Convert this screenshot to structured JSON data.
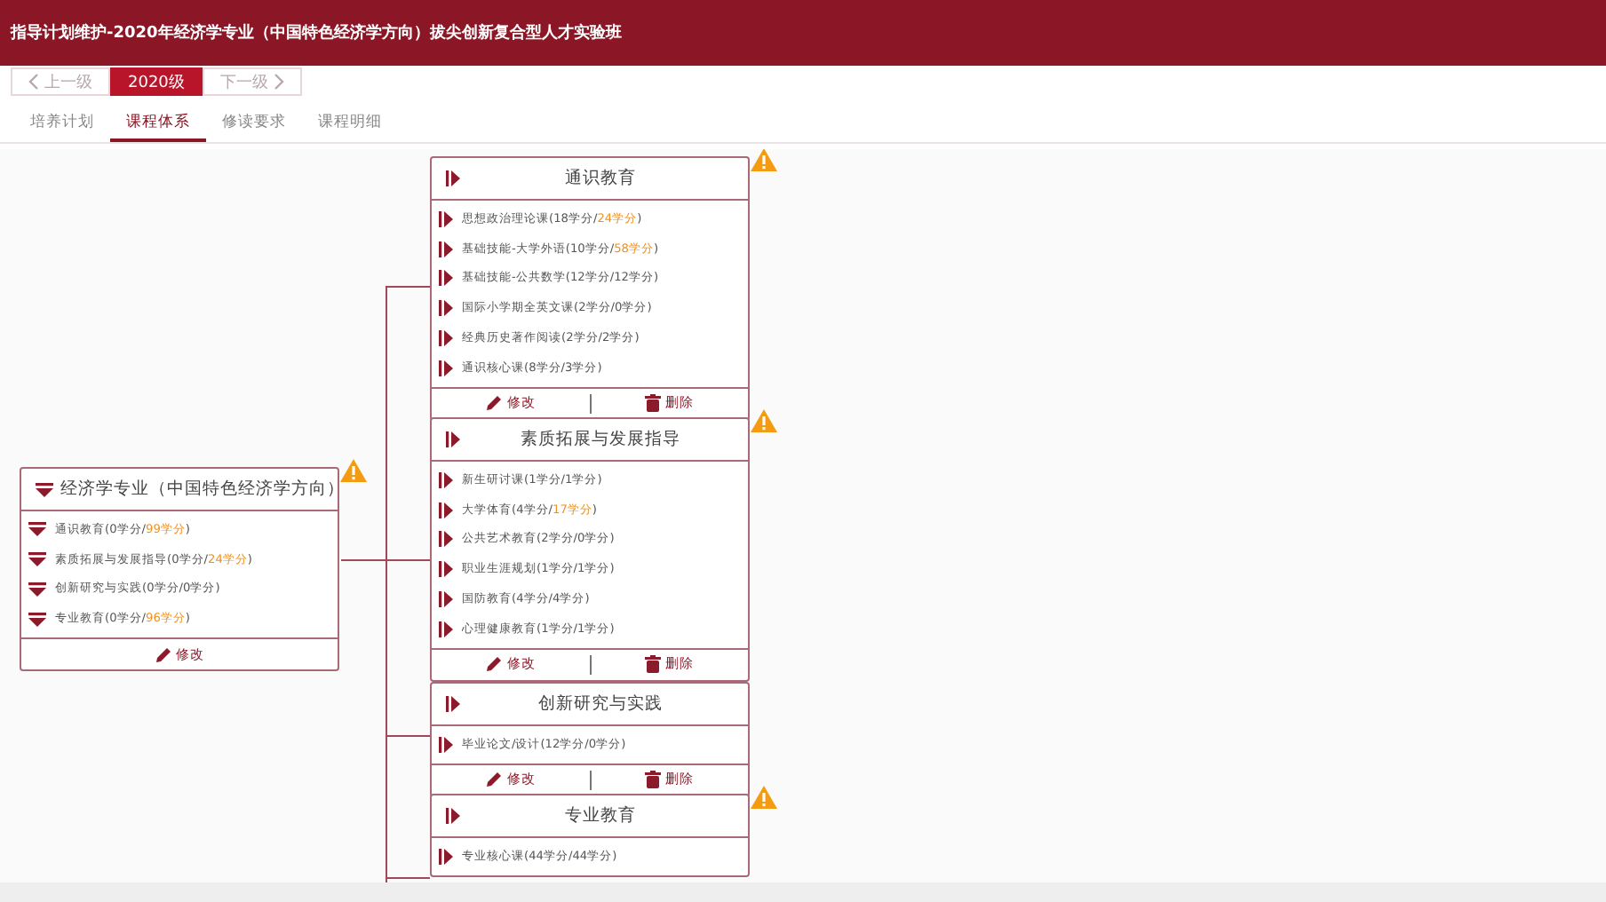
{
  "header": {
    "title": "指导计划维护-2020年经济学专业（中国特色经济学方向）拔尖创新复合型人才实验班"
  },
  "grade_nav": [
    {
      "label": "上一级",
      "kind": "prev",
      "disabled": true
    },
    {
      "label": "2020级",
      "kind": "current",
      "disabled": false
    },
    {
      "label": "下一级",
      "kind": "next",
      "disabled": true
    }
  ],
  "tabs": [
    {
      "label": "培养计划",
      "selected": false
    },
    {
      "label": "课程体系",
      "selected": true
    },
    {
      "label": "修读要求",
      "selected": false
    },
    {
      "label": "课程明细",
      "selected": false
    }
  ],
  "root": {
    "title": "经济学专业（中国特色经济学方向）",
    "warning": true,
    "edit": "修改",
    "items": [
      {
        "before": "通识教育(0学分/",
        "required": "99学分",
        "after": ")",
        "short": true
      },
      {
        "before": "素质拓展与发展指导(0学分/",
        "required": "24学分",
        "after": ")",
        "short": true
      },
      {
        "before": "创新研究与实践(0学分/",
        "required": "0学分",
        "after": ")",
        "short": false
      },
      {
        "before": "专业教育(0学分/",
        "required": "96学分",
        "after": ")",
        "short": true
      }
    ]
  },
  "groups": [
    {
      "title": "通识教育",
      "warning": true,
      "edit": "修改",
      "delete": "删除",
      "items": [
        {
          "before": "思想政治理论课(18学分/",
          "required": "24学分",
          "after": ")",
          "short": true
        },
        {
          "before": "基础技能-大学外语(10学分/",
          "required": "58学分",
          "after": ")",
          "short": true
        },
        {
          "before": "基础技能-公共数学(12学分/",
          "required": "12学分",
          "after": ")",
          "short": false
        },
        {
          "before": "国际小学期全英文课(2学分/",
          "required": "0学分",
          "after": ")",
          "short": false
        },
        {
          "before": "经典历史著作阅读(2学分/",
          "required": "2学分",
          "after": ")",
          "short": false
        },
        {
          "before": "通识核心课(8学分/",
          "required": "3学分",
          "after": ")",
          "short": false
        }
      ]
    },
    {
      "title": "素质拓展与发展指导",
      "warning": true,
      "edit": "修改",
      "delete": "删除",
      "items": [
        {
          "before": "新生研讨课(1学分/",
          "required": "1学分",
          "after": ")",
          "short": false
        },
        {
          "before": "大学体育(4学分/",
          "required": "17学分",
          "after": ")",
          "short": true
        },
        {
          "before": "公共艺术教育(2学分/",
          "required": "0学分",
          "after": ")",
          "short": false
        },
        {
          "before": "职业生涯规划(1学分/",
          "required": "1学分",
          "after": ")",
          "short": false
        },
        {
          "before": "国防教育(4学分/",
          "required": "4学分",
          "after": ")",
          "short": false
        },
        {
          "before": "心理健康教育(1学分/",
          "required": "1学分",
          "after": ")",
          "short": false
        }
      ]
    },
    {
      "title": "创新研究与实践",
      "warning": false,
      "edit": "修改",
      "delete": "删除",
      "items": [
        {
          "before": "毕业论文/设计(12学分/",
          "required": "0学分",
          "after": ")",
          "short": false
        }
      ]
    },
    {
      "title": "专业教育",
      "warning": true,
      "items": [
        {
          "before": "专业核心课(44学分/",
          "required": "44学分",
          "after": ")",
          "short": false
        }
      ]
    }
  ]
}
